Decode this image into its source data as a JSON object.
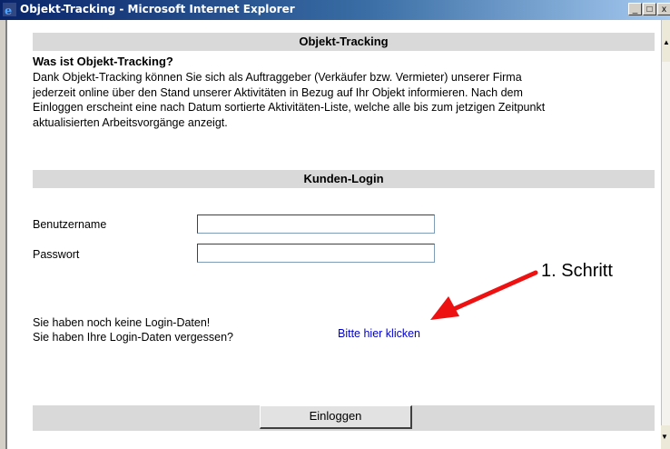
{
  "window": {
    "title": "Objekt-Tracking - Microsoft Internet Explorer",
    "minimize_glyph": "_",
    "maximize_glyph": "□",
    "close_glyph": "x"
  },
  "page": {
    "header": "Objekt-Tracking",
    "question": "Was ist Objekt-Tracking?",
    "description_lines": [
      "Dank Objekt-Tracking können Sie sich als Auftraggeber (Verkäufer bzw. Vermieter) unserer Firma",
      "jederzeit online über den Stand unserer Aktivitäten in Bezug auf Ihr Objekt informieren. Nach dem",
      "Einloggen erscheint eine nach Datum sortierte Aktivitäten-Liste, welche alle bis zum jetzigen Zeitpunkt",
      "aktualisierten Arbeitsvorgänge anzeigt."
    ],
    "login_section_title": "Kunden-Login",
    "username_label": "Benutzername",
    "username_value": "",
    "password_label": "Passwort",
    "password_value": "",
    "no_login_text": "Sie haben noch keine Login-Daten!",
    "forgot_login_text": "Sie haben Ihre Login-Daten vergessen?",
    "link_text": "Bitte hier klicken",
    "login_button": "Einloggen"
  },
  "annotation": {
    "text": "1. Schritt",
    "arrow_color": "#ee1111"
  },
  "icons": {
    "title_icon": "internet-explorer-icon"
  }
}
